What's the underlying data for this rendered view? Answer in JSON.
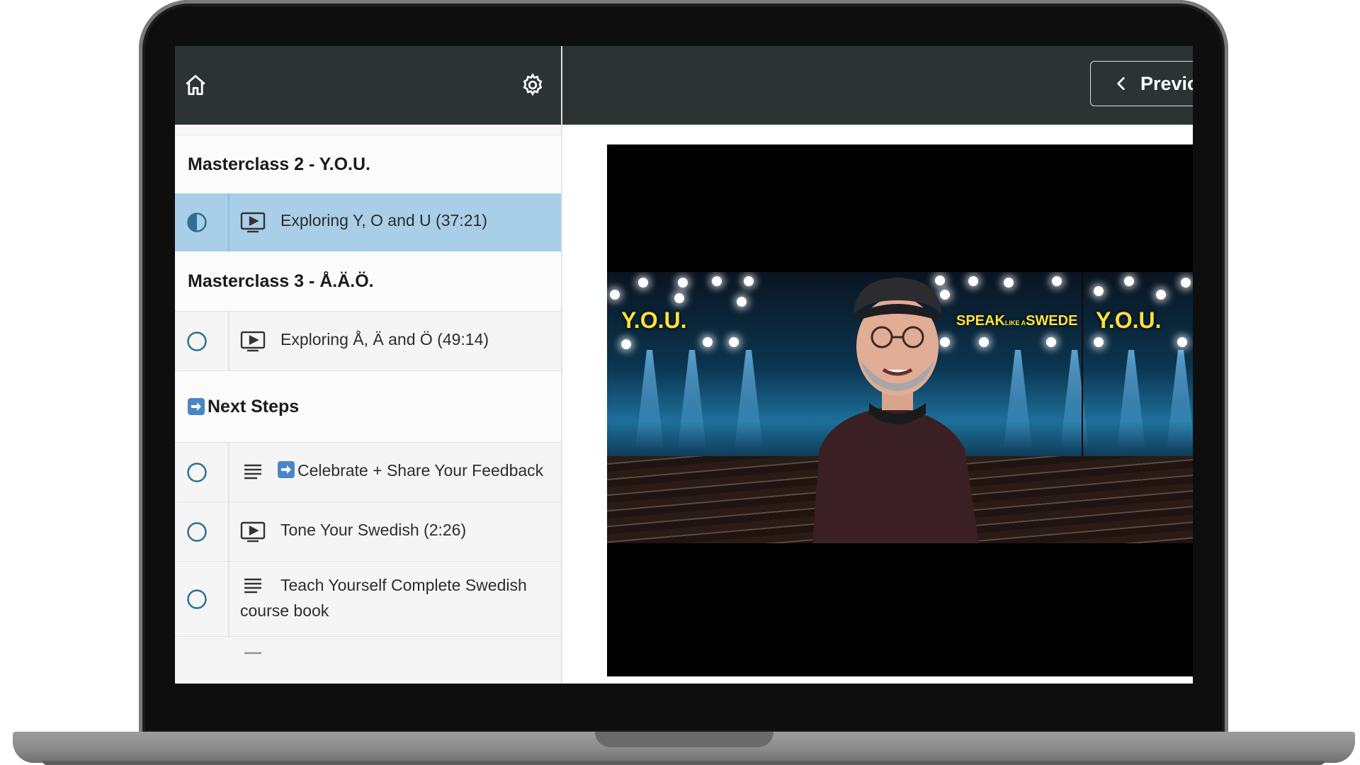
{
  "header": {
    "prev_label": "Previo"
  },
  "sidebar": {
    "sections": [
      {
        "title": "Masterclass 2 - Y.O.U.",
        "items": [
          {
            "type": "video",
            "status": "in-progress",
            "label": "Exploring Y, O and U (37:21)",
            "active": true
          }
        ]
      },
      {
        "title": "Masterclass 3 - Å.Ä.Ö.",
        "items": [
          {
            "type": "video",
            "status": "not-started",
            "label": "Exploring Å, Ä and Ö (49:14)"
          }
        ]
      },
      {
        "title": "Next Steps",
        "title_icon": "arrow-right-emoji-icon",
        "items": [
          {
            "type": "text",
            "status": "not-started",
            "label": "Celebrate + Share Your Feedback",
            "label_icon": "arrow-right-emoji-icon"
          },
          {
            "type": "video",
            "status": "not-started",
            "label": "Tone Your Swedish (2:26)"
          },
          {
            "type": "text",
            "status": "not-started",
            "label_line1": "Teach Yourself Complete Swedish",
            "label_line2": "course book"
          }
        ]
      }
    ]
  },
  "video": {
    "overlay_left": "Y.O.U.",
    "overlay_brand_a": "SPEAK",
    "overlay_brand_small": "LIKE A",
    "overlay_brand_b": "SWEDE",
    "overlay_right": "Y.O.U."
  },
  "colors": {
    "topbar": "#2b3433",
    "active_row": "#a9cfe8",
    "status_ring": "#2f6f96",
    "brand_text": "#ffe23a"
  }
}
